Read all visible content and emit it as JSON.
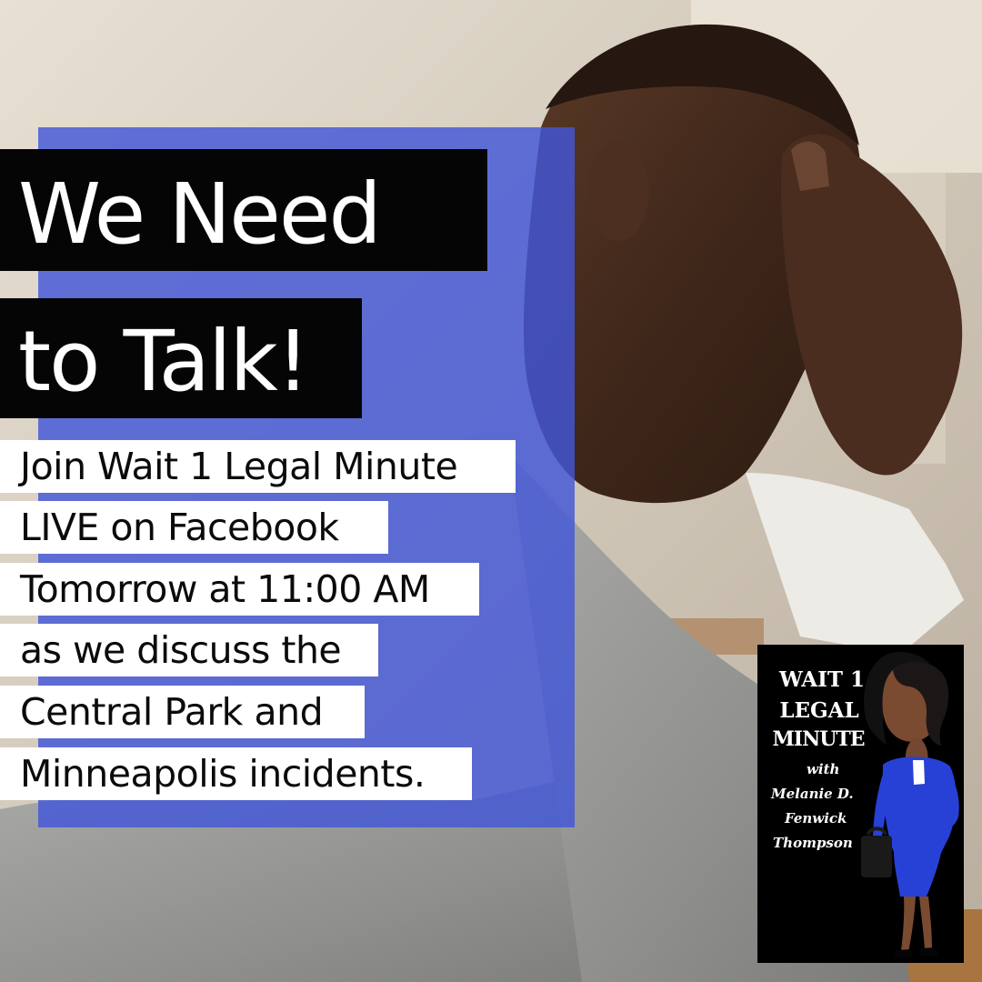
{
  "headline": {
    "line1": "We Need",
    "line2": "to Talk!"
  },
  "details": [
    "Join Wait 1 Legal Minute",
    "LIVE on Facebook",
    "Tomorrow at 11:00 AM",
    "as we discuss the",
    "Central Park and",
    "Minneapolis incidents."
  ],
  "logo": {
    "title": [
      "WAIT 1",
      "LEGAL",
      "MINUTE"
    ],
    "with": "with",
    "name": [
      "Melanie D.",
      "Fenwick",
      "Thompson"
    ]
  },
  "colors": {
    "accent_blue": "#4257d8",
    "headline_bg": "#050505",
    "caption_bg": "#ffffff",
    "logo_bg": "#000000"
  },
  "images": {
    "background": "stressed-man-photo",
    "logo_character": "cartoon-woman-in-blue-suit"
  }
}
